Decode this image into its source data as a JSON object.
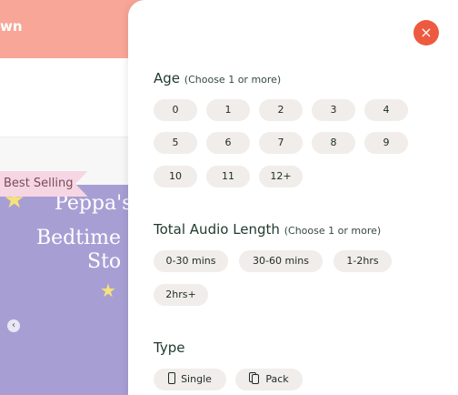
{
  "background": {
    "header_text": "wn",
    "badge": "Best Selling",
    "book": {
      "line1": "Peppa's",
      "line2": "Bedtime",
      "line3": "Sto"
    },
    "prev_arrow": "‹"
  },
  "drawer": {
    "close_icon": "×",
    "age": {
      "title": "Age",
      "hint": "(Choose 1 or more)",
      "options": [
        "0",
        "1",
        "2",
        "3",
        "4",
        "5",
        "6",
        "7",
        "8",
        "9",
        "10",
        "11",
        "12+"
      ]
    },
    "audio": {
      "title": "Total Audio Length",
      "hint": "(Choose 1 or more)",
      "options": [
        "0-30 mins",
        "30-60 mins",
        "1-2hrs",
        "2hrs+"
      ]
    },
    "type": {
      "title": "Type",
      "options": [
        {
          "label": "Single",
          "icon": "single-card-icon"
        },
        {
          "label": "Pack",
          "icon": "pack-cards-icon"
        }
      ]
    }
  },
  "colors": {
    "header_bg": "#f8a697",
    "close_button": "#ee5a3f",
    "chip_bg": "#f0edea",
    "title_text": "#1f3a2c"
  }
}
